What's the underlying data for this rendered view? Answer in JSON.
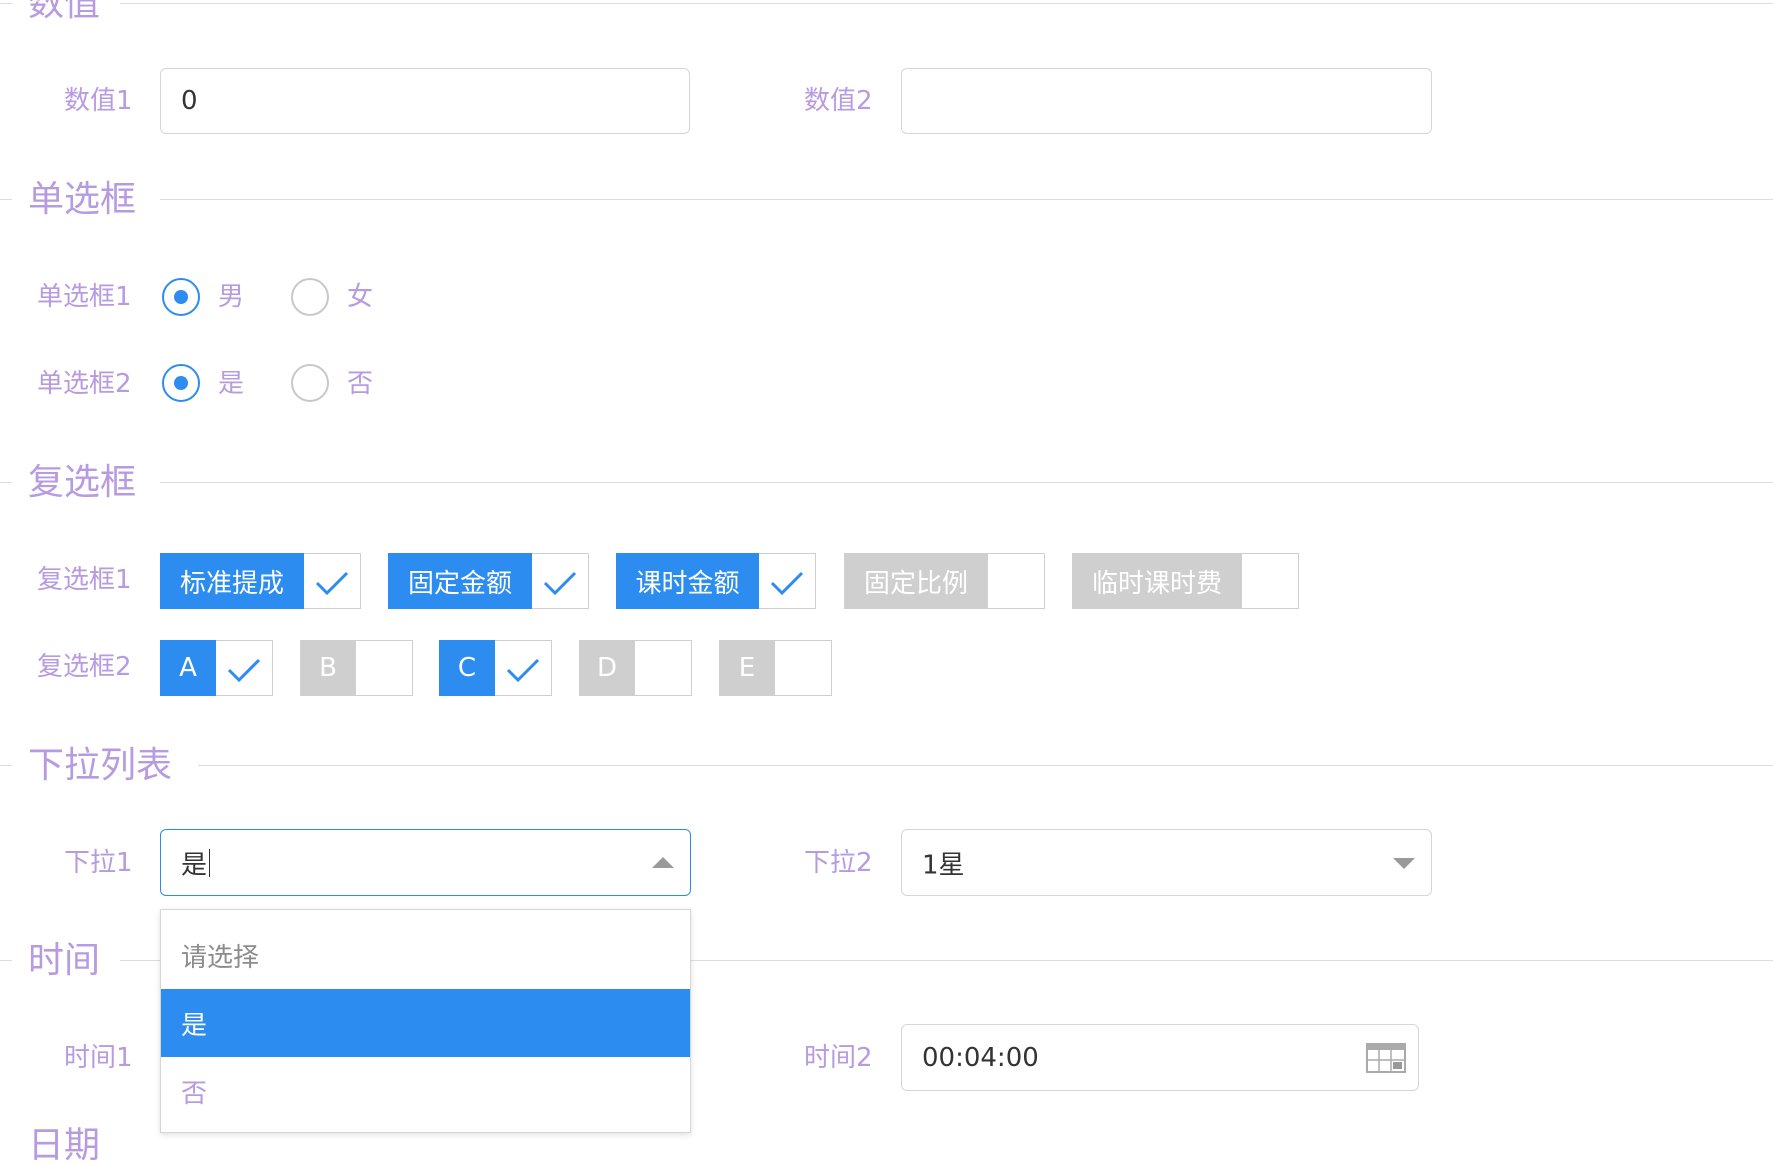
{
  "sections": {
    "numbers": {
      "title": "数值"
    },
    "radios": {
      "title": "单选框"
    },
    "checkboxes": {
      "title": "复选框"
    },
    "dropdowns": {
      "title": "下拉列表"
    },
    "time": {
      "title": "时间"
    },
    "date": {
      "title": "日期"
    }
  },
  "numbers": {
    "field1": {
      "label": "数值1",
      "value": "0"
    },
    "field2": {
      "label": "数值2",
      "value": ""
    }
  },
  "radios": {
    "group1": {
      "label": "单选框1",
      "options": [
        "男",
        "女"
      ],
      "selected": "男"
    },
    "group2": {
      "label": "单选框2",
      "options": [
        "是",
        "否"
      ],
      "selected": "是"
    }
  },
  "checkboxes": {
    "group1": {
      "label": "复选框1",
      "options": [
        {
          "text": "标准提成",
          "checked": true
        },
        {
          "text": "固定金额",
          "checked": true
        },
        {
          "text": "课时金额",
          "checked": true
        },
        {
          "text": "固定比例",
          "checked": false
        },
        {
          "text": "临时课时费",
          "checked": false
        }
      ]
    },
    "group2": {
      "label": "复选框2",
      "options": [
        {
          "text": "A",
          "checked": true
        },
        {
          "text": "B",
          "checked": false
        },
        {
          "text": "C",
          "checked": true
        },
        {
          "text": "D",
          "checked": false
        },
        {
          "text": "E",
          "checked": false
        }
      ]
    }
  },
  "dropdowns": {
    "select1": {
      "label": "下拉1",
      "value": "是",
      "open": true,
      "options": [
        "请选择",
        "是",
        "否"
      ],
      "highlighted": "是"
    },
    "select2": {
      "label": "下拉2",
      "value": "1星",
      "open": false
    }
  },
  "time": {
    "field1": {
      "label": "时间1"
    },
    "field2": {
      "label": "时间2",
      "value": "00:04:00"
    }
  },
  "colors": {
    "accent": "#2d8cf0",
    "label": "#b79be0",
    "disabled_tag": "#cfcfcf",
    "border": "#d6d6d6"
  },
  "icons": {
    "check": "check-icon",
    "arrow_up": "chevron-up-icon",
    "arrow_down": "chevron-down-icon",
    "time_picker": "calendar-icon"
  }
}
